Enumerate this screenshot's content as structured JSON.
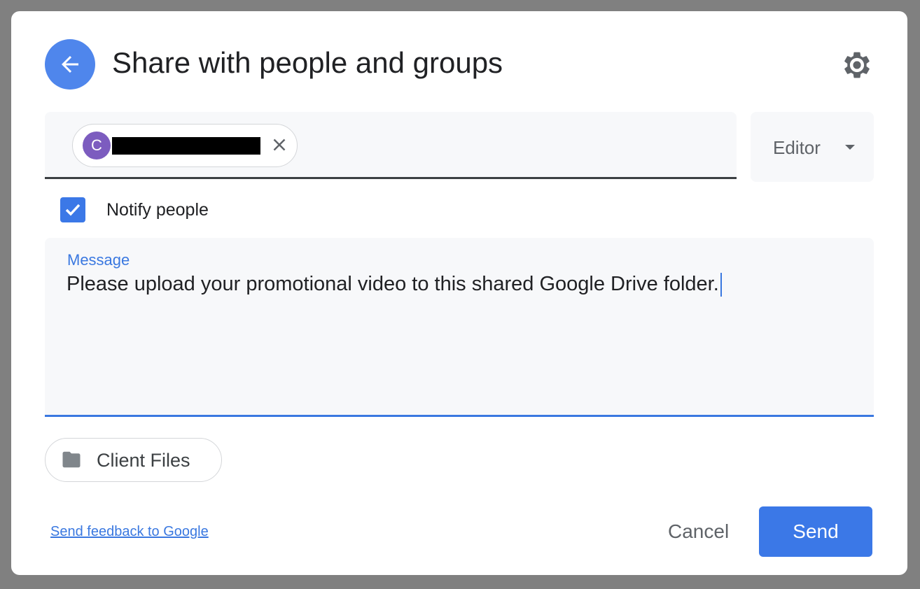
{
  "dialog": {
    "title": "Share with people and groups",
    "back_icon": "arrow-left-icon",
    "settings_icon": "gear-icon"
  },
  "recipients": {
    "chips": [
      {
        "avatar_letter": "C",
        "avatar_color": "#7c5cbf",
        "name_redacted": true
      }
    ]
  },
  "role": {
    "selected": "Editor"
  },
  "notify": {
    "label": "Notify people",
    "checked": true
  },
  "message": {
    "label": "Message",
    "value": "Please upload your promotional video to this shared Google Drive folder."
  },
  "item": {
    "name": "Client Files",
    "icon": "folder-icon"
  },
  "footer": {
    "feedback": "Send feedback to Google",
    "cancel": "Cancel",
    "send": "Send"
  },
  "colors": {
    "accent": "#3b78e7"
  }
}
